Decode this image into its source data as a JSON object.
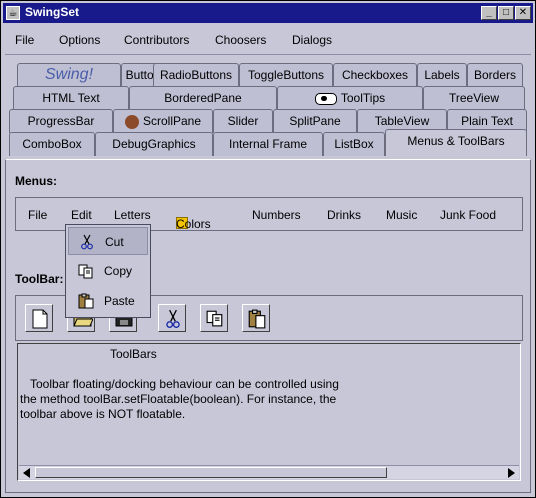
{
  "window": {
    "title": "SwingSet",
    "minimize": "_",
    "maximize": "□",
    "close": "✕"
  },
  "menubar": [
    "File",
    "Options",
    "Contributors",
    "Choosers",
    "Dialogs"
  ],
  "tabs": {
    "row1": [
      "Swing!",
      "Buttons",
      "RadioButtons",
      "ToggleButtons",
      "Checkboxes",
      "Labels",
      "Borders"
    ],
    "row2": [
      "HTML Text",
      "BorderedPane",
      "ToolTips",
      "TreeView"
    ],
    "row3": [
      "ProgressBar",
      "ScrollPane",
      "Slider",
      "SplitPane",
      "TableView",
      "Plain Text"
    ],
    "row4": [
      "ComboBox",
      "DebugGraphics",
      "Internal Frame",
      "ListBox",
      "Menus & ToolBars"
    ],
    "selected": "Menus & ToolBars"
  },
  "menus_section": {
    "label": "Menus:",
    "items": [
      "File",
      "Edit",
      "Letters",
      "Colors",
      "Numbers",
      "Drinks",
      "Music",
      "Junk Food"
    ]
  },
  "edit_popup": {
    "items": [
      "Cut",
      "Copy",
      "Paste"
    ]
  },
  "toolbar_section": {
    "label": "ToolBar:",
    "buttons": [
      "new-icon",
      "open-icon",
      "save-icon",
      "cut-icon",
      "copy-icon",
      "paste-icon"
    ]
  },
  "text_panel": {
    "heading": "ToolBars",
    "lines": [
      "Toolbar floating/docking behaviour can be controlled using",
      "the method toolBar.setFloatable(boolean).  For instance, the",
      "toolbar above is NOT floatable."
    ]
  },
  "colors": {
    "titlebar": "#18198a",
    "background": "#c7c7d8",
    "swing_label": "#4a5ea8",
    "colors_swatch": "#f5c400"
  }
}
